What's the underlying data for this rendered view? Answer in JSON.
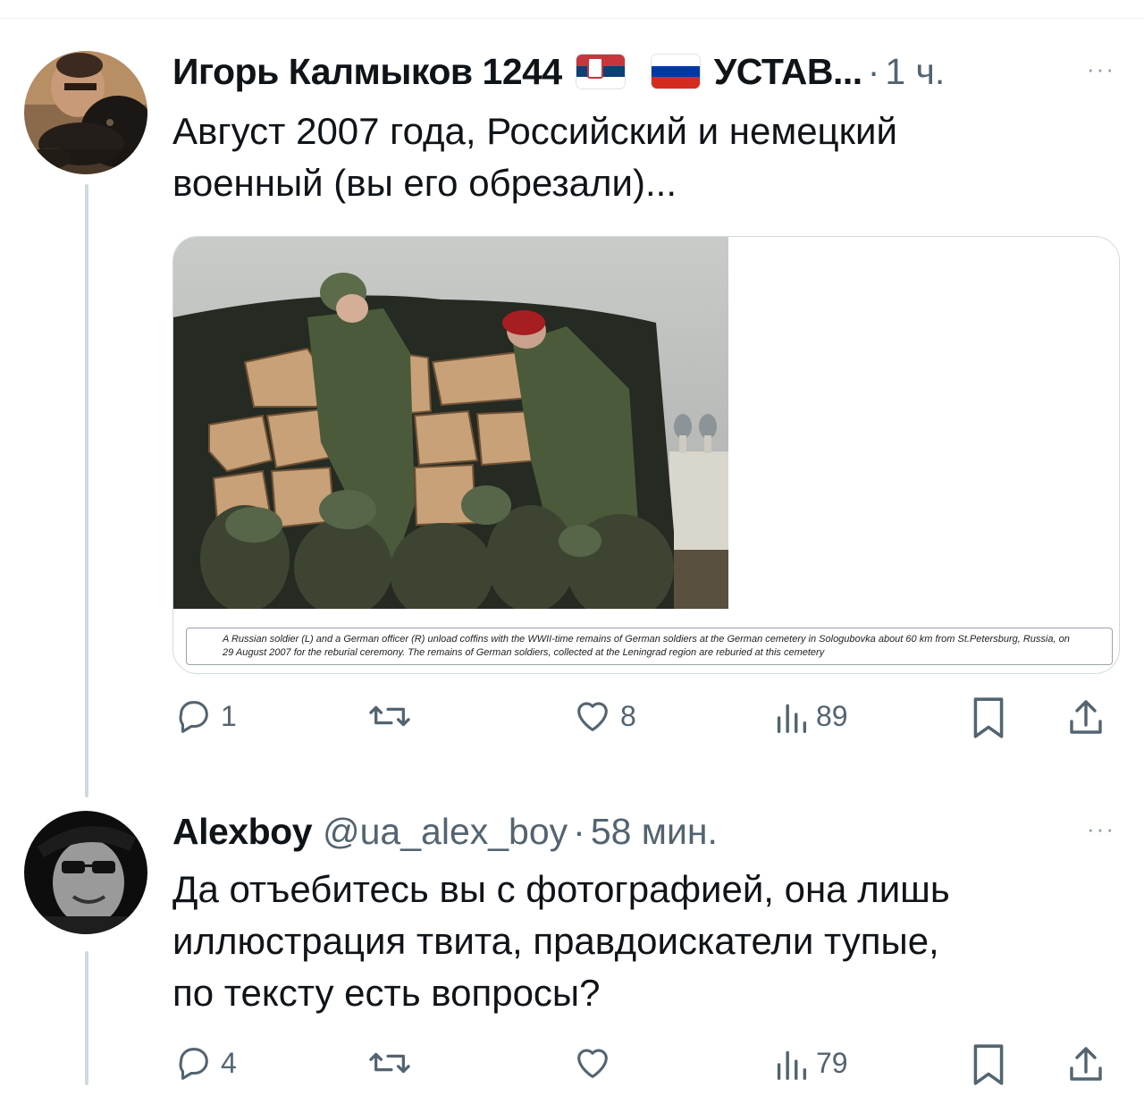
{
  "tweets": [
    {
      "author_name": "Игорь Калмыков 1244",
      "author_suffix": "УСТАВ...",
      "flags": [
        "serbia-flag",
        "russia-flag"
      ],
      "separator": "·",
      "time": "1 ч.",
      "more": "···",
      "text": "Август 2007 года, Российский и немецкий\nвоенный (вы его обрезали)...",
      "media": {
        "caption": "A Russian soldier (L) and a German officer (R) unload coffins with the WWII-time remains of German soldiers at the German cemetery in Sologubovka about 60 km from St.Petersburg, Russia, on 29 August 2007 for the reburial ceremony. The remains of German soldiers, collected at the Leningrad region are reburied at this cemetery"
      },
      "actions": {
        "replies": "1",
        "reposts": "",
        "likes": "8",
        "views": "89"
      }
    },
    {
      "author_name": "Alexboy",
      "handle": "@ua_alex_boy",
      "separator": "·",
      "time": "58 мин.",
      "more": "···",
      "text": "Да отъебитесь вы с фотографией, она лишь\nиллюстрация твита, правдоискатели тупые,\nпо тексту есть вопросы?",
      "actions": {
        "replies": "4",
        "reposts": "",
        "likes": "",
        "views": "79"
      }
    }
  ],
  "colors": {
    "text": "#0f1419",
    "secondary": "#536471",
    "thread_line": "#cfd9de",
    "card_border": "#cfd9de"
  }
}
